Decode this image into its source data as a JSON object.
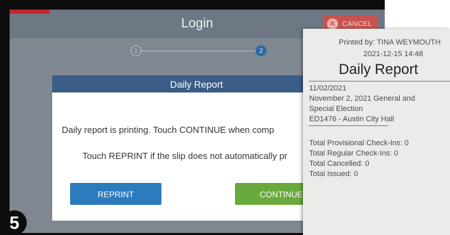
{
  "header": {
    "title": "Login",
    "cancel_label": "CANCEL"
  },
  "steps": [
    {
      "number": "1"
    },
    {
      "number": "2"
    }
  ],
  "dialog": {
    "title": "Daily Report",
    "message_1": "Daily report is printing. Touch CONTINUE when comp",
    "message_2": "Touch REPRINT if the slip does not automatically pr",
    "reprint_label": "REPRINT",
    "continue_label": "CONTINUE"
  },
  "step_badge": "5",
  "receipt": {
    "printed_by": "Printed by: TINA WEYMOUTH",
    "datetime": "2021-12-15 14:48",
    "title": "Daily Report",
    "date": "11/02/2021",
    "election_line_1": "November 2, 2021 General and",
    "election_line_2": "Special Election",
    "location": "ED1476 - Austin City Hall",
    "total_provisional": "Total Provisional Check-Ins: 0",
    "total_regular": "Total Regular Check-Ins: 0",
    "total_cancelled": "Total Cancelled: 0",
    "total_issued": "Total Issued: 0"
  },
  "colors": {
    "accent": "#2b7bbd",
    "continue": "#69a93d",
    "cancel": "#c9534e",
    "dialog_header": "#3a5c86"
  }
}
